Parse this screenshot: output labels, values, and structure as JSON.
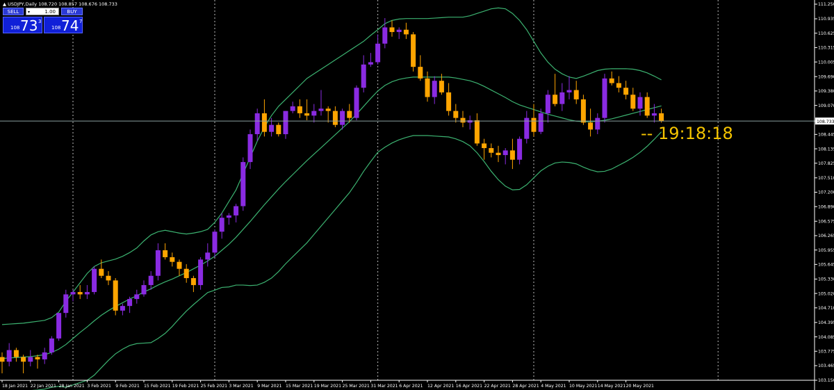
{
  "window": {
    "symbol_title": "▲ USDJPY,Daily  108.720 108.857 108.676 108.733"
  },
  "trade_panel": {
    "sell_label": "SELL",
    "buy_label": "BUY",
    "lot_value": "1.00",
    "lot_arrow": "▾",
    "sell_price_small": "108",
    "sell_price_big": "73",
    "sell_price_sup": "3",
    "buy_price_small": "108",
    "buy_price_big": "74",
    "buy_price_sup": "7"
  },
  "countdown": {
    "text": "-- 19:18:18"
  },
  "colors": {
    "background": "#000000",
    "bull_candle": "#8a2be2",
    "bear_candle": "#ffa500",
    "bands": "#3cb371",
    "axis": "#ffffff",
    "current_price_line": "#8aa0a0",
    "countdown": "#f5c400",
    "panel_blue": "#1020d8"
  },
  "chart_data": {
    "type": "candlestick",
    "symbol": "USDJPY",
    "timeframe": "Daily",
    "current_price": "108.733",
    "ylim": [
      103.15,
      111.25
    ],
    "y_ticks": [
      "111.250",
      "110.935",
      "110.625",
      "110.315",
      "110.005",
      "109.690",
      "109.380",
      "109.070",
      "108.733",
      "108.445",
      "108.135",
      "107.825",
      "107.510",
      "107.200",
      "106.890",
      "106.575",
      "106.265",
      "105.955",
      "105.645",
      "105.330",
      "105.020",
      "104.710",
      "104.395",
      "104.085",
      "103.775",
      "103.465",
      "103.150"
    ],
    "x_labels": [
      {
        "label": "18 Jan 2021",
        "i": 0
      },
      {
        "label": "22 Jan 2021",
        "i": 4
      },
      {
        "label": "28 Jan 2021",
        "i": 8
      },
      {
        "label": "3 Feb 2021",
        "i": 12
      },
      {
        "label": "9 Feb 2021",
        "i": 16
      },
      {
        "label": "15 Feb 2021",
        "i": 20
      },
      {
        "label": "19 Feb 2021",
        "i": 24
      },
      {
        "label": "25 Feb 2021",
        "i": 28
      },
      {
        "label": "3 Mar 2021",
        "i": 32
      },
      {
        "label": "9 Mar 2021",
        "i": 36
      },
      {
        "label": "15 Mar 2021",
        "i": 40
      },
      {
        "label": "19 Mar 2021",
        "i": 44
      },
      {
        "label": "25 Mar 2021",
        "i": 48
      },
      {
        "label": "31 Mar 2021",
        "i": 52
      },
      {
        "label": "6 Apr 2021",
        "i": 56
      },
      {
        "label": "12 Apr 2021",
        "i": 60
      },
      {
        "label": "16 Apr 2021",
        "i": 64
      },
      {
        "label": "22 Apr 2021",
        "i": 68
      },
      {
        "label": "28 Apr 2021",
        "i": 72
      },
      {
        "label": "4 May 2021",
        "i": 76
      },
      {
        "label": "10 May 2021",
        "i": 80
      },
      {
        "label": "14 May 2021",
        "i": 84
      },
      {
        "label": "20 May 2021",
        "i": 88
      }
    ],
    "period_separators": [
      10,
      30,
      53,
      75,
      101
    ],
    "candles": [
      [
        103.65,
        103.75,
        103.3,
        103.55
      ],
      [
        103.55,
        103.95,
        103.45,
        103.8
      ],
      [
        103.8,
        103.85,
        103.55,
        103.65
      ],
      [
        103.65,
        103.7,
        103.3,
        103.55
      ],
      [
        103.55,
        103.8,
        103.45,
        103.65
      ],
      [
        103.65,
        103.7,
        103.4,
        103.6
      ],
      [
        103.6,
        103.85,
        103.5,
        103.75
      ],
      [
        103.75,
        104.1,
        103.7,
        104.05
      ],
      [
        104.05,
        104.45,
        104.0,
        104.6
      ],
      [
        104.6,
        105.1,
        104.5,
        105.0
      ],
      [
        105.0,
        105.1,
        104.85,
        105.05
      ],
      [
        105.05,
        105.2,
        104.9,
        105.0
      ],
      [
        105.0,
        105.2,
        104.9,
        105.05
      ],
      [
        105.05,
        105.6,
        105.0,
        105.55
      ],
      [
        105.55,
        105.75,
        105.35,
        105.4
      ],
      [
        105.4,
        105.5,
        105.2,
        105.3
      ],
      [
        105.3,
        105.35,
        104.55,
        104.65
      ],
      [
        104.65,
        104.8,
        104.55,
        104.75
      ],
      [
        104.75,
        104.95,
        104.6,
        104.9
      ],
      [
        104.9,
        105.1,
        104.8,
        105.0
      ],
      [
        105.0,
        105.3,
        104.95,
        105.2
      ],
      [
        105.2,
        105.5,
        105.1,
        105.4
      ],
      [
        105.4,
        106.1,
        105.3,
        105.95
      ],
      [
        105.95,
        106.1,
        105.75,
        105.8
      ],
      [
        105.8,
        105.9,
        105.6,
        105.7
      ],
      [
        105.7,
        105.75,
        105.4,
        105.55
      ],
      [
        105.55,
        105.65,
        105.25,
        105.35
      ],
      [
        105.35,
        105.4,
        105.05,
        105.2
      ],
      [
        105.2,
        105.8,
        105.1,
        105.75
      ],
      [
        105.75,
        106.1,
        105.6,
        105.9
      ],
      [
        105.9,
        106.4,
        105.8,
        106.35
      ],
      [
        106.35,
        106.75,
        106.2,
        106.65
      ],
      [
        106.65,
        106.75,
        106.5,
        106.7
      ],
      [
        106.7,
        106.95,
        106.55,
        106.9
      ],
      [
        106.9,
        107.95,
        106.8,
        107.85
      ],
      [
        107.85,
        108.55,
        107.7,
        108.45
      ],
      [
        108.45,
        109.0,
        108.3,
        108.9
      ],
      [
        108.9,
        109.2,
        108.4,
        108.5
      ],
      [
        108.5,
        108.8,
        108.4,
        108.65
      ],
      [
        108.65,
        108.7,
        108.4,
        108.45
      ],
      [
        108.45,
        108.95,
        108.35,
        108.95
      ],
      [
        108.95,
        109.15,
        108.9,
        109.05
      ],
      [
        109.05,
        109.2,
        108.8,
        108.9
      ],
      [
        108.9,
        109.2,
        108.75,
        108.85
      ],
      [
        108.85,
        109.1,
        108.7,
        108.95
      ],
      [
        108.95,
        109.4,
        108.85,
        109.0
      ],
      [
        109.0,
        109.05,
        108.7,
        108.95
      ],
      [
        108.95,
        109.05,
        108.6,
        108.65
      ],
      [
        108.65,
        109.0,
        108.55,
        108.95
      ],
      [
        108.95,
        109.1,
        108.7,
        108.8
      ],
      [
        108.8,
        109.5,
        108.75,
        109.45
      ],
      [
        109.45,
        110.15,
        109.35,
        109.95
      ],
      [
        109.95,
        110.2,
        109.9,
        110.0
      ],
      [
        110.0,
        110.6,
        109.95,
        110.4
      ],
      [
        110.4,
        110.95,
        110.3,
        110.75
      ],
      [
        110.75,
        110.9,
        110.55,
        110.65
      ],
      [
        110.65,
        110.75,
        110.5,
        110.7
      ],
      [
        110.7,
        110.85,
        110.5,
        110.6
      ],
      [
        110.6,
        110.65,
        109.8,
        109.9
      ],
      [
        109.9,
        110.15,
        109.6,
        109.65
      ],
      [
        109.65,
        109.8,
        109.15,
        109.25
      ],
      [
        109.25,
        109.7,
        109.1,
        109.6
      ],
      [
        109.6,
        109.75,
        109.3,
        109.35
      ],
      [
        109.35,
        109.55,
        108.85,
        108.95
      ],
      [
        108.95,
        109.1,
        108.7,
        108.8
      ],
      [
        108.8,
        108.95,
        108.6,
        108.7
      ],
      [
        108.7,
        108.85,
        108.55,
        108.75
      ],
      [
        108.75,
        108.9,
        108.2,
        108.25
      ],
      [
        108.25,
        108.35,
        107.9,
        108.15
      ],
      [
        108.15,
        108.25,
        107.95,
        108.05
      ],
      [
        108.05,
        108.2,
        107.85,
        108.0
      ],
      [
        108.0,
        108.15,
        107.8,
        108.1
      ],
      [
        108.1,
        108.35,
        107.7,
        107.9
      ],
      [
        107.9,
        108.4,
        107.8,
        108.35
      ],
      [
        108.35,
        108.95,
        108.25,
        108.8
      ],
      [
        108.8,
        109.1,
        108.4,
        108.5
      ],
      [
        108.5,
        109.0,
        108.45,
        108.9
      ],
      [
        108.9,
        109.4,
        108.7,
        109.3
      ],
      [
        109.3,
        109.75,
        109.05,
        109.1
      ],
      [
        109.1,
        109.55,
        108.95,
        109.35
      ],
      [
        109.35,
        109.7,
        109.2,
        109.4
      ],
      [
        109.4,
        109.6,
        109.1,
        109.2
      ],
      [
        109.2,
        109.3,
        108.65,
        108.7
      ],
      [
        108.7,
        109.0,
        108.4,
        108.55
      ],
      [
        108.55,
        108.9,
        108.45,
        108.8
      ],
      [
        108.8,
        109.75,
        108.7,
        109.65
      ],
      [
        109.65,
        109.8,
        109.5,
        109.55
      ],
      [
        109.55,
        109.7,
        109.35,
        109.45
      ],
      [
        109.45,
        109.6,
        109.2,
        109.3
      ],
      [
        109.3,
        109.45,
        108.95,
        109.0
      ],
      [
        109.0,
        109.35,
        108.85,
        109.25
      ],
      [
        109.25,
        109.35,
        108.8,
        108.85
      ],
      [
        108.85,
        109.1,
        108.7,
        108.9
      ],
      [
        108.9,
        109.0,
        108.7,
        108.73
      ]
    ],
    "bollinger_upper": [
      104.35,
      104.36,
      104.37,
      104.38,
      104.4,
      104.42,
      104.44,
      104.5,
      104.62,
      104.85,
      105.05,
      105.25,
      105.45,
      105.6,
      105.68,
      105.72,
      105.76,
      105.82,
      105.9,
      106.0,
      106.15,
      106.28,
      106.35,
      106.38,
      106.35,
      106.32,
      106.3,
      106.32,
      106.35,
      106.4,
      106.55,
      106.75,
      107.0,
      107.25,
      107.6,
      107.95,
      108.3,
      108.6,
      108.85,
      109.05,
      109.2,
      109.35,
      109.5,
      109.65,
      109.75,
      109.85,
      109.95,
      110.05,
      110.15,
      110.25,
      110.35,
      110.45,
      110.58,
      110.7,
      110.83,
      110.9,
      110.93,
      110.94,
      110.94,
      110.94,
      110.94,
      110.95,
      110.96,
      110.97,
      110.97,
      110.97,
      111.0,
      111.05,
      111.1,
      111.15,
      111.17,
      111.15,
      111.05,
      110.9,
      110.7,
      110.45,
      110.2,
      110.0,
      109.85,
      109.75,
      109.68,
      109.65,
      109.7,
      109.76,
      109.82,
      109.85,
      109.86,
      109.86,
      109.86,
      109.85,
      109.82,
      109.77,
      109.7,
      109.62
    ],
    "bollinger_middle": [
      103.62,
      103.63,
      103.64,
      103.65,
      103.66,
      103.68,
      103.7,
      103.75,
      103.82,
      103.92,
      104.05,
      104.18,
      104.3,
      104.43,
      104.55,
      104.65,
      104.74,
      104.82,
      104.9,
      104.97,
      105.05,
      105.12,
      105.2,
      105.27,
      105.33,
      105.4,
      105.47,
      105.55,
      105.63,
      105.72,
      105.82,
      105.95,
      106.08,
      106.23,
      106.4,
      106.57,
      106.75,
      106.93,
      107.1,
      107.27,
      107.43,
      107.58,
      107.73,
      107.88,
      108.02,
      108.16,
      108.3,
      108.44,
      108.58,
      108.72,
      108.88,
      109.05,
      109.22,
      109.38,
      109.5,
      109.58,
      109.63,
      109.66,
      109.68,
      109.68,
      109.68,
      109.68,
      109.68,
      109.68,
      109.66,
      109.63,
      109.6,
      109.55,
      109.48,
      109.4,
      109.32,
      109.24,
      109.15,
      109.08,
      109.03,
      108.98,
      108.93,
      108.88,
      108.84,
      108.8,
      108.76,
      108.73,
      108.72,
      108.72,
      108.73,
      108.75,
      108.78,
      108.82,
      108.86,
      108.9,
      108.94,
      108.98,
      109.02,
      109.06
    ],
    "bollinger_lower": [
      102.9,
      102.91,
      102.91,
      102.92,
      102.93,
      102.94,
      102.96,
      103.0,
      103.02,
      103.0,
      103.05,
      103.1,
      103.15,
      103.26,
      103.42,
      103.58,
      103.72,
      103.82,
      103.9,
      103.94,
      103.95,
      103.96,
      104.05,
      104.16,
      104.31,
      104.48,
      104.64,
      104.78,
      104.91,
      105.04,
      105.09,
      105.15,
      105.16,
      105.2,
      105.2,
      105.19,
      105.2,
      105.26,
      105.35,
      105.49,
      105.66,
      105.81,
      105.96,
      106.11,
      106.29,
      106.47,
      106.65,
      106.83,
      107.01,
      107.19,
      107.41,
      107.65,
      107.86,
      108.06,
      108.17,
      108.26,
      108.33,
      108.38,
      108.42,
      108.42,
      108.42,
      108.41,
      108.4,
      108.39,
      108.35,
      108.29,
      108.2,
      108.05,
      107.86,
      107.65,
      107.47,
      107.33,
      107.25,
      107.26,
      107.36,
      107.51,
      107.66,
      107.76,
      107.83,
      107.85,
      107.84,
      107.81,
      107.74,
      107.68,
      107.64,
      107.65,
      107.7,
      107.78,
      107.86,
      107.95,
      108.06,
      108.19,
      108.34,
      108.5
    ]
  }
}
